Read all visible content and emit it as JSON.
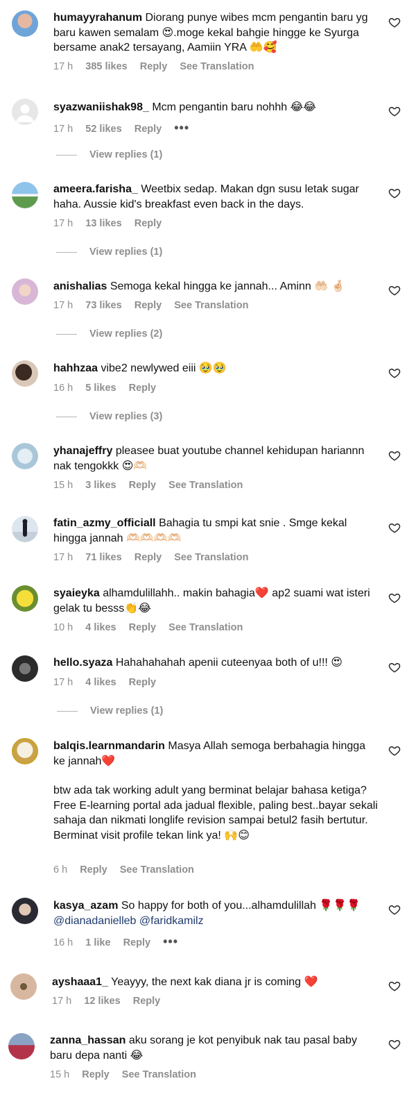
{
  "comments": [
    {
      "username": "humayyrahanum",
      "text": "Diorang punye wibes mcm pengantin baru yg baru kawen semalam 😍.moge kekal bahgie hingge ke Syurga bersame anak2 tersayang, Aamiin YRA 🤲🥰",
      "time": "17 h",
      "likes": "385 likes",
      "reply": "Reply",
      "translation": "See Translation"
    },
    {
      "username": "syazwaniishak98_",
      "text": "Mcm pengantin baru nohhh 😂😂",
      "time": "17 h",
      "likes": "52 likes",
      "reply": "Reply",
      "more": "•••",
      "view_replies": "View replies (1)"
    },
    {
      "username": "ameera.farisha_",
      "text": "Weetbix sedap. Makan dgn susu letak sugar haha. Aussie kid's breakfast even back in the days.",
      "time": "17 h",
      "likes": "13 likes",
      "reply": "Reply",
      "view_replies": "View replies (1)"
    },
    {
      "username": "anishalias",
      "text": "Semoga kekal hingga ke jannah... Aminn 🤲🏻 🤞🏻",
      "time": "17 h",
      "likes": "73 likes",
      "reply": "Reply",
      "translation": "See Translation",
      "view_replies": "View replies (2)"
    },
    {
      "username": "hahhzaa",
      "text": "vibe2 newlywed eiii 🥹🥹",
      "time": "16 h",
      "likes": "5 likes",
      "reply": "Reply",
      "view_replies": "View replies (3)"
    },
    {
      "username": "yhanajeffry",
      "text": "pleasee buat youtube channel kehidupan hariannn nak tengokkk 😍🫶🏻",
      "time": "15 h",
      "likes": "3 likes",
      "reply": "Reply",
      "translation": "See Translation"
    },
    {
      "username": "fatin_azmy_officiall",
      "text": "Bahagia tu smpi kat snie . Smge kekal hingga jannah 🫶🏻🫶🏻🫶🏻🫶🏻",
      "time": "17 h",
      "likes": "71 likes",
      "reply": "Reply",
      "translation": "See Translation"
    },
    {
      "username": "syaieyka",
      "text": "alhamdulillahh.. makin bahagia❤️ ap2 suami wat isteri gelak tu besss👏😂",
      "time": "10 h",
      "likes": "4 likes",
      "reply": "Reply",
      "translation": "See Translation"
    },
    {
      "username": "hello.syaza",
      "text": "Hahahahahah apenii cuteenyaa both of u!!! 😍",
      "time": "17 h",
      "likes": "4 likes",
      "reply": "Reply",
      "view_replies": "View replies (1)"
    },
    {
      "username": "balqis.learnmandarin",
      "text": "Masya Allah semoga berbahagia hingga ke jannah❤️",
      "text2": "btw ada tak working adult yang berminat belajar bahasa ketiga? Free E-learning portal ada jadual flexible, paling best..bayar sekali sahaja dan nikmati longlife revision sampai betul2 fasih bertutur. Berminat visit profile tekan link ya! 🙌😊",
      "time": "6 h",
      "reply": "Reply",
      "translation": "See Translation"
    },
    {
      "username": "kasya_azam",
      "text": "So happy for both of you...alhamdulillah 🌹🌹🌹",
      "mention1": "@dianadanielleb",
      "mention2": "@faridkamilz",
      "time": "16 h",
      "likes": "1 like",
      "reply": "Reply",
      "more": "•••"
    },
    {
      "username": "ayshaaa1_",
      "text": "Yeayyy, the next kak diana jr is coming ❤️",
      "time": "17 h",
      "likes": "12 likes",
      "reply": "Reply"
    },
    {
      "username": "zanna_hassan",
      "text": "aku sorang je kot penyibuk nak tau pasal baby baru depa nanti 😂",
      "time": "15 h",
      "reply": "Reply",
      "translation": "See Translation"
    }
  ],
  "colors": {
    "meta": "#8e8e8e",
    "mention": "#1f3a6e",
    "text": "#111111"
  }
}
